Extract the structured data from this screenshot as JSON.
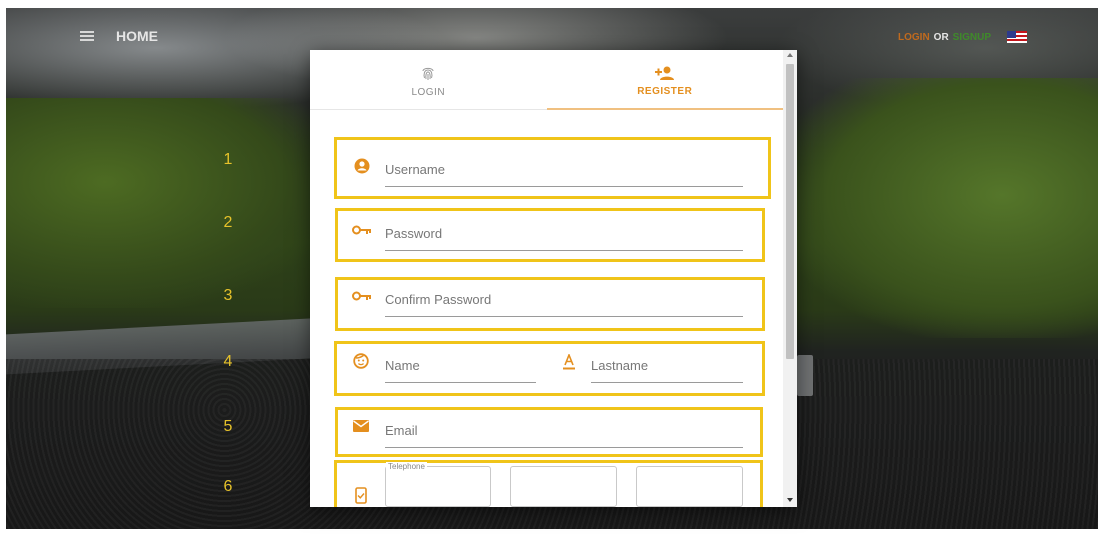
{
  "nav": {
    "home_label": "HOME",
    "auth": {
      "login": "LOGIN",
      "or": "OR",
      "signup": "SIGNUP"
    }
  },
  "modal": {
    "tabs": [
      {
        "label": "LOGIN",
        "icon": "fingerprint-icon"
      },
      {
        "label": "REGISTER",
        "icon": "add-user-icon"
      }
    ],
    "form": {
      "username_placeholder": "Username",
      "password_placeholder": "Password",
      "confirm_password_placeholder": "Confirm Password",
      "name_placeholder": "Name",
      "lastname_placeholder": "Lastname",
      "email_placeholder": "Email",
      "telephone_label": "Telephone"
    }
  },
  "annotations": [
    "1",
    "2",
    "3",
    "4",
    "5",
    "6"
  ],
  "colors": {
    "accent": "#e48f1f",
    "highlight": "#f0c419",
    "signup": "#3f8a2a",
    "login": "#c06a1e"
  }
}
